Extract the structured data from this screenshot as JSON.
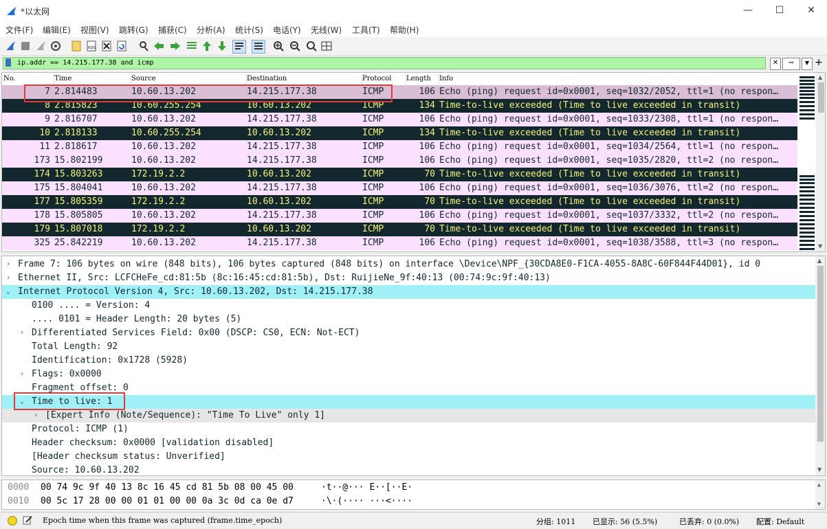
{
  "window": {
    "title": "*以太网"
  },
  "menu": [
    "文件(F)",
    "编辑(E)",
    "视图(V)",
    "跳转(G)",
    "捕获(C)",
    "分析(A)",
    "统计(S)",
    "电话(Y)",
    "无线(W)",
    "工具(T)",
    "帮助(H)"
  ],
  "filter": {
    "value": "ip.addr == 14.215.177.38 and icmp"
  },
  "columns": {
    "no": "No.",
    "time": "Time",
    "source": "Source",
    "destination": "Destination",
    "protocol": "Protocol",
    "length": "Length",
    "info": "Info"
  },
  "packets": [
    {
      "no": "7",
      "time": "2.814483",
      "src": "10.60.13.202",
      "dst": "14.215.177.38",
      "proto": "ICMP",
      "len": "106",
      "info": "Echo (ping) request  id=0x0001, seq=1032/2052, ttl=1 (no respon…",
      "kind": "sel"
    },
    {
      "no": "8",
      "time": "2.815823",
      "src": "10.60.255.254",
      "dst": "10.60.13.202",
      "proto": "ICMP",
      "len": "134",
      "info": "Time-to-live exceeded (Time to live exceeded in transit)",
      "kind": "ttl"
    },
    {
      "no": "9",
      "time": "2.816707",
      "src": "10.60.13.202",
      "dst": "14.215.177.38",
      "proto": "ICMP",
      "len": "106",
      "info": "Echo (ping) request  id=0x0001, seq=1033/2308, ttl=1 (no respon…",
      "kind": "req"
    },
    {
      "no": "10",
      "time": "2.818133",
      "src": "10.60.255.254",
      "dst": "10.60.13.202",
      "proto": "ICMP",
      "len": "134",
      "info": "Time-to-live exceeded (Time to live exceeded in transit)",
      "kind": "ttl"
    },
    {
      "no": "11",
      "time": "2.818617",
      "src": "10.60.13.202",
      "dst": "14.215.177.38",
      "proto": "ICMP",
      "len": "106",
      "info": "Echo (ping) request  id=0x0001, seq=1034/2564, ttl=1 (no respon…",
      "kind": "req"
    },
    {
      "no": "173",
      "time": "15.802199",
      "src": "10.60.13.202",
      "dst": "14.215.177.38",
      "proto": "ICMP",
      "len": "106",
      "info": "Echo (ping) request  id=0x0001, seq=1035/2820, ttl=2 (no respon…",
      "kind": "req"
    },
    {
      "no": "174",
      "time": "15.803263",
      "src": "172.19.2.2",
      "dst": "10.60.13.202",
      "proto": "ICMP",
      "len": "70",
      "info": "Time-to-live exceeded (Time to live exceeded in transit)",
      "kind": "ttl"
    },
    {
      "no": "175",
      "time": "15.804041",
      "src": "10.60.13.202",
      "dst": "14.215.177.38",
      "proto": "ICMP",
      "len": "106",
      "info": "Echo (ping) request  id=0x0001, seq=1036/3076, ttl=2 (no respon…",
      "kind": "req"
    },
    {
      "no": "177",
      "time": "15.805359",
      "src": "172.19.2.2",
      "dst": "10.60.13.202",
      "proto": "ICMP",
      "len": "70",
      "info": "Time-to-live exceeded (Time to live exceeded in transit)",
      "kind": "ttl"
    },
    {
      "no": "178",
      "time": "15.805805",
      "src": "10.60.13.202",
      "dst": "14.215.177.38",
      "proto": "ICMP",
      "len": "106",
      "info": "Echo (ping) request  id=0x0001, seq=1037/3332, ttl=2 (no respon…",
      "kind": "req"
    },
    {
      "no": "179",
      "time": "15.807018",
      "src": "172.19.2.2",
      "dst": "10.60.13.202",
      "proto": "ICMP",
      "len": "70",
      "info": "Time-to-live exceeded (Time to live exceeded in transit)",
      "kind": "ttl"
    },
    {
      "no": "325",
      "time": "25.842219",
      "src": "10.60.13.202",
      "dst": "14.215.177.38",
      "proto": "ICMP",
      "len": "106",
      "info": "Echo (ping) request  id=0x0001, seq=1038/3588, ttl=3 (no respon…",
      "kind": "req"
    }
  ],
  "details": [
    {
      "text": "Frame 7: 106 bytes on wire (848 bits), 106 bytes captured (848 bits) on interface \\Device\\NPF_{30CDA8E0-F1CA-4055-8A8C-60F844F44D01}, id 0",
      "indent": 0,
      "exp": "›"
    },
    {
      "text": "Ethernet II, Src: LCFCHeFe_cd:81:5b (8c:16:45:cd:81:5b), Dst: RuijieNe_9f:40:13 (00:74:9c:9f:40:13)",
      "indent": 0,
      "exp": "›"
    },
    {
      "text": "Internet Protocol Version 4, Src: 10.60.13.202, Dst: 14.215.177.38",
      "indent": 0,
      "exp": "⌄",
      "hl": true
    },
    {
      "text": "0100 .... = Version: 4",
      "indent": 1,
      "exp": ""
    },
    {
      "text": ".... 0101 = Header Length: 20 bytes (5)",
      "indent": 1,
      "exp": ""
    },
    {
      "text": "Differentiated Services Field: 0x00 (DSCP: CS0, ECN: Not-ECT)",
      "indent": 1,
      "exp": "›"
    },
    {
      "text": "Total Length: 92",
      "indent": 1,
      "exp": ""
    },
    {
      "text": "Identification: 0x1728 (5928)",
      "indent": 1,
      "exp": ""
    },
    {
      "text": "Flags: 0x0000",
      "indent": 1,
      "exp": "›"
    },
    {
      "text": "Fragment offset: 0",
      "indent": 1,
      "exp": ""
    },
    {
      "text": "Time to live: 1",
      "indent": 1,
      "exp": "⌄",
      "hl": true
    },
    {
      "text": "[Expert Info (Note/Sequence): \"Time To Live\" only 1]",
      "indent": 2,
      "exp": "›",
      "gray": true
    },
    {
      "text": "Protocol: ICMP (1)",
      "indent": 1,
      "exp": ""
    },
    {
      "text": "Header checksum: 0x0000 [validation disabled]",
      "indent": 1,
      "exp": ""
    },
    {
      "text": "[Header checksum status: Unverified]",
      "indent": 1,
      "exp": ""
    },
    {
      "text": "Source: 10.60.13.202",
      "indent": 1,
      "exp": ""
    }
  ],
  "bytes": [
    {
      "offset": "0000",
      "hex": "00 74 9c 9f 40 13 8c 16  45 cd 81 5b 08 00 45 00",
      "ascii": "·t··@··· E··[··E·"
    },
    {
      "offset": "0010",
      "hex": "00 5c 17 28 00 00 01 01  00 00 0a 3c 0d ca 0e d7",
      "ascii": "·\\·(···· ···<····"
    }
  ],
  "status": {
    "field": "Epoch time when this frame was captured (frame.time_epoch)",
    "packets": "分组: 1011",
    "displayed": "已显示: 56 (5.5%)",
    "dropped": "已丢弃: 0 (0.0%)",
    "profile": "配置: Default"
  },
  "colors": {
    "request_bg": "#fce0ff",
    "ttl_bg": "#12272e",
    "ttl_fg": "#f7f379",
    "selected_bg": "#d9bed6",
    "highlight": "#a0f0f8",
    "filter_bg": "#aff5a7",
    "annotation": "#e53935"
  }
}
